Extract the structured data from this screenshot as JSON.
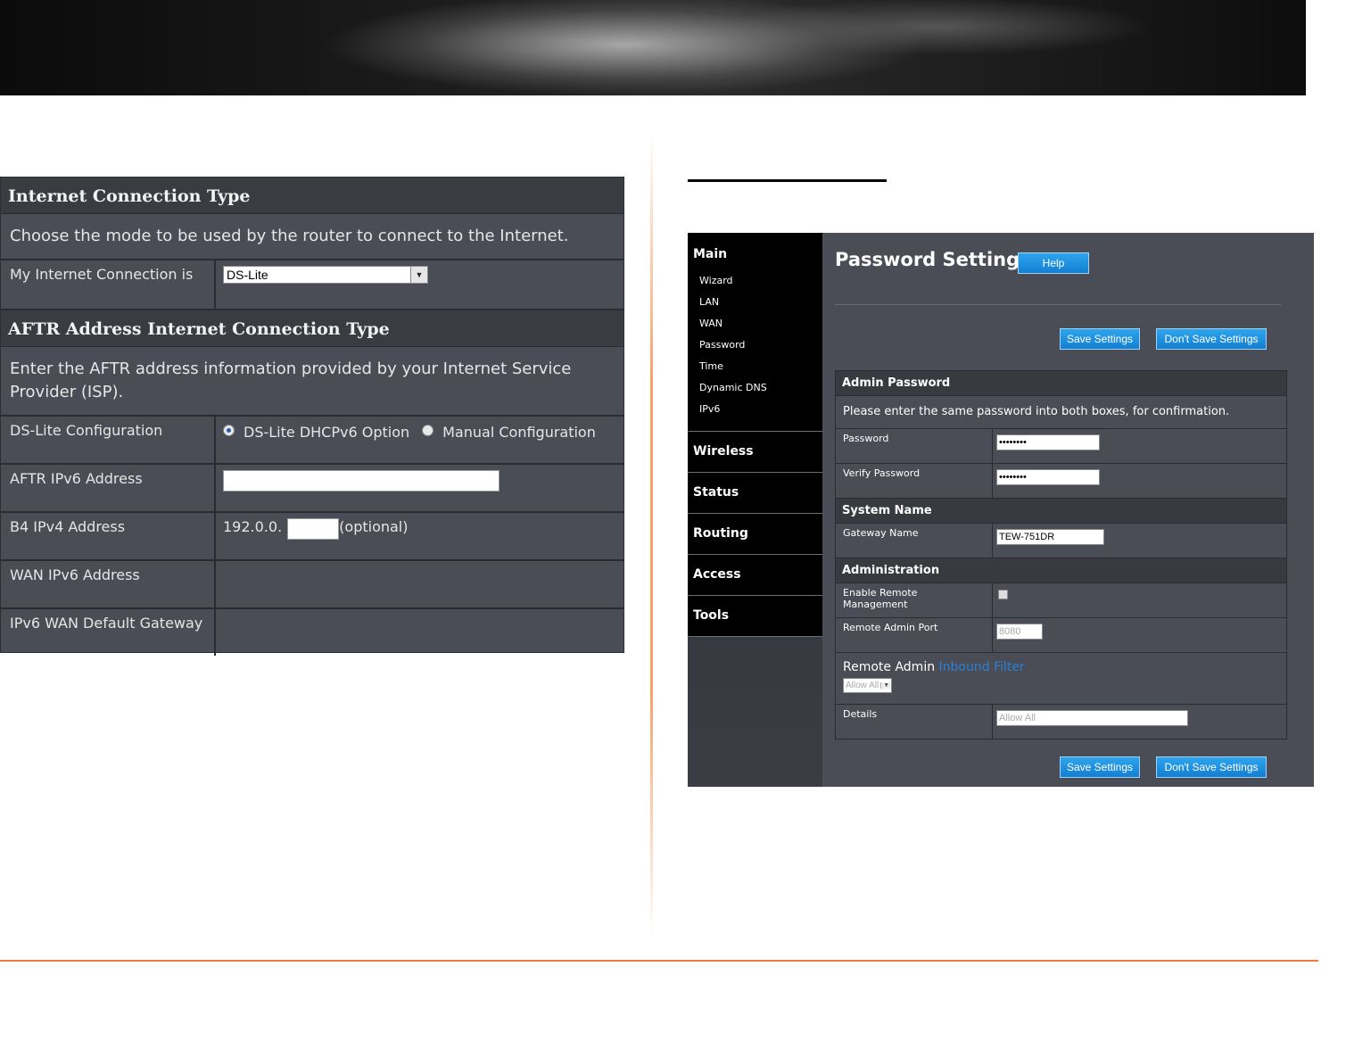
{
  "left_panel": {
    "section1_title": "Internet Connection Type",
    "section1_desc": "Choose the mode to be used by the router to connect to the Internet.",
    "connection_label": "My Internet Connection is",
    "connection_value": "DS-Lite",
    "section2_title": "AFTR Address Internet Connection Type",
    "section2_desc": "Enter the AFTR address information provided by your Internet Service Provider (ISP).",
    "dslite_config_label": "DS-Lite Configuration",
    "option_dhcpv6": "DS-Lite DHCPv6 Option",
    "option_manual": "Manual Configuration",
    "aftr_label": "AFTR IPv6 Address",
    "b4_label": "B4 IPv4 Address",
    "b4_prefix": "192.0.0.",
    "b4_optional": "(optional)",
    "wan_ipv6_label": "WAN IPv6 Address",
    "ipv6_gateway_label": "IPv6 WAN Default Gateway"
  },
  "right_panel": {
    "sidebar": {
      "main": "Main",
      "items": [
        "Wizard",
        "LAN",
        "WAN",
        "Password",
        "Time",
        "Dynamic DNS",
        "IPv6"
      ],
      "sections": [
        "Wireless",
        "Status",
        "Routing",
        "Access",
        "Tools"
      ]
    },
    "title": "Password Settings",
    "help": "Help",
    "save": "Save Settings",
    "dont_save": "Don't Save Settings",
    "admin_password_title": "Admin Password",
    "admin_password_desc": "Please enter the same password into both boxes, for confirmation.",
    "password_label": "Password",
    "password_value": "••••••••",
    "verify_label": "Verify Password",
    "verify_value": "••••••••",
    "system_name_title": "System Name",
    "gateway_name_label": "Gateway Name",
    "gateway_name_value": "TEW-751DR",
    "administration_title": "Administration",
    "enable_remote_label": "Enable Remote Management",
    "remote_port_label": "Remote Admin Port",
    "remote_port_value": "8080",
    "remote_admin_label": "Remote Admin",
    "inbound_filter_link": "Inbound Filter",
    "allow_all_select": "Allow All",
    "details_label": "Details",
    "details_value": "Allow All"
  }
}
